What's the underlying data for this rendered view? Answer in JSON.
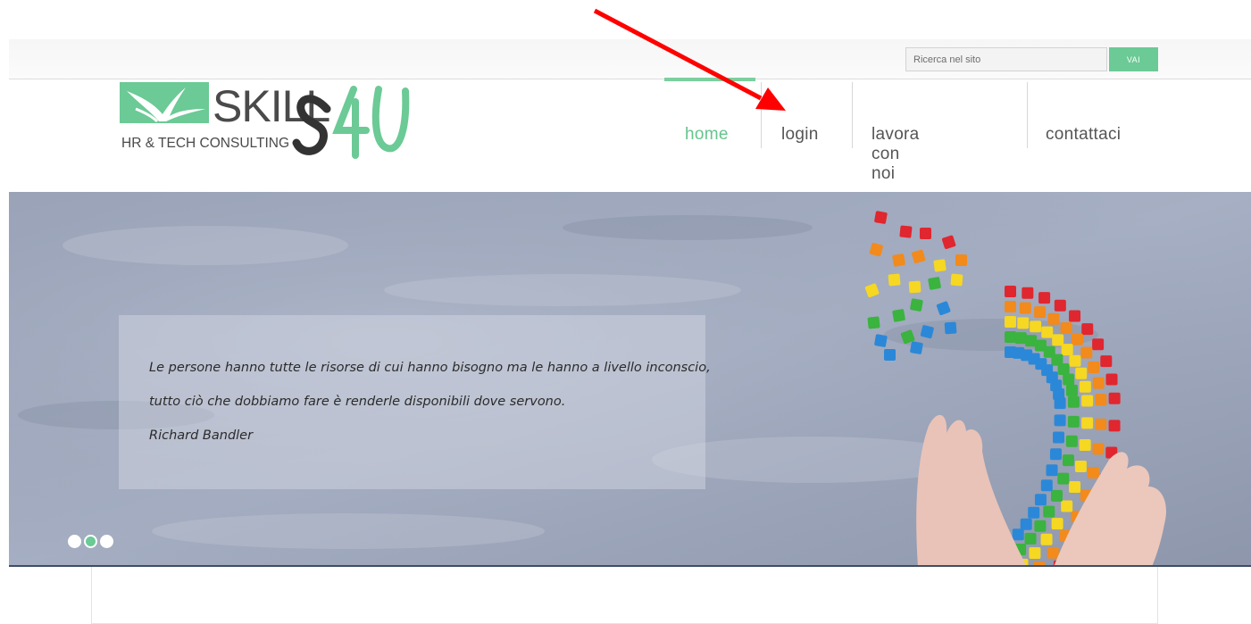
{
  "search": {
    "placeholder": "Ricerca nel sito",
    "button_label": "VAI"
  },
  "logo": {
    "brand": "SKILL",
    "brand_suffix": "S4U",
    "tagline": "HR & TECH CONSULTING"
  },
  "nav": {
    "items": [
      {
        "label": "home",
        "active": true
      },
      {
        "label": "login",
        "active": false
      },
      {
        "label": "lavora con noi",
        "active": false
      },
      {
        "label": "contattaci",
        "active": false
      }
    ]
  },
  "hero": {
    "quote_line1": "Le persone hanno tutte le risorse di cui hanno bisogno ma le hanno a livello inconscio,",
    "quote_line2": "tutto ciò che dobbiamo fare è renderle disponibili dove servono.",
    "author": "Richard Bandler",
    "slides_count": 3,
    "active_slide": 2
  },
  "colors": {
    "accent": "#6bca95",
    "nav_text": "#555555",
    "annotation_arrow": "#ff0000"
  }
}
